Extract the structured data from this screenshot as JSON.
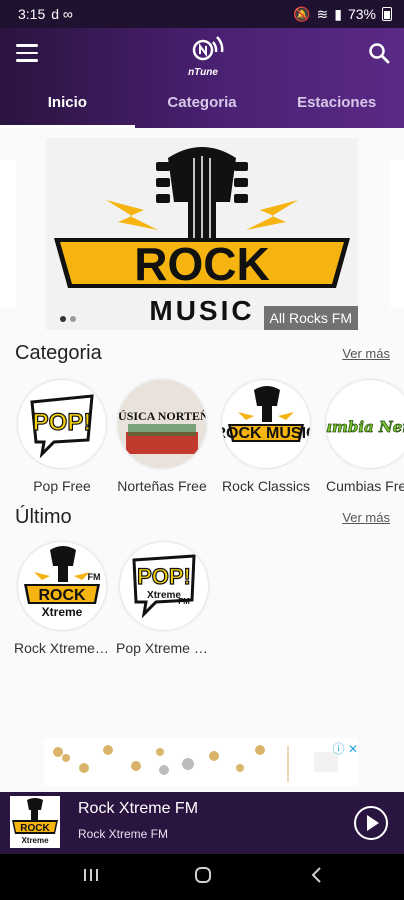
{
  "status": {
    "time": "3:15",
    "indicators": "d ∞",
    "battery": "73%"
  },
  "app": {
    "brand": "nTune"
  },
  "tabs": [
    {
      "label": "Inicio",
      "active": true
    },
    {
      "label": "Categoria",
      "active": false
    },
    {
      "label": "Estaciones",
      "active": false
    }
  ],
  "banner": {
    "logo_top": "ROCK",
    "logo_bottom": "MUSIC",
    "caption": "All Rocks FM"
  },
  "categoria": {
    "title": "Categoria",
    "see_more": "Ver más",
    "items": [
      {
        "label": "Pop Free",
        "art": "POP!"
      },
      {
        "label": "Norteñas Free",
        "art": "MÚSICA NORTEÑA"
      },
      {
        "label": "Rock Classics",
        "art": "ROCK MUSIC"
      },
      {
        "label": "Cumbias Free",
        "art": "Cumbia Nena"
      }
    ]
  },
  "ultimo": {
    "title": "Último",
    "see_more": "Ver más",
    "items": [
      {
        "label": "Rock Xtreme FM",
        "art_top": "ROCK",
        "art_bottom": "Xtreme",
        "art_tag": "FM"
      },
      {
        "label": "Pop Xtreme FM",
        "art_top": "POP!",
        "art_bottom": "Xtreme",
        "art_tag": "FM"
      }
    ]
  },
  "player": {
    "title": "Rock Xtreme FM",
    "subtitle": "Rock Xtreme FM",
    "thumb_top": "ROCK",
    "thumb_bottom": "Xtreme"
  },
  "colors": {
    "purple": "#4b2173",
    "dark_purple": "#2a1440",
    "accent_yellow": "#f5b40f"
  }
}
